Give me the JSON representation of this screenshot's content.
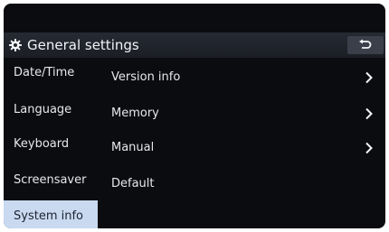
{
  "header": {
    "title": "General settings",
    "icon": "gear-icon",
    "back_icon": "back-icon"
  },
  "sidebar": {
    "items": [
      {
        "label": "Date/Time",
        "active": false
      },
      {
        "label": "Language",
        "active": false
      },
      {
        "label": "Keyboard",
        "active": false
      },
      {
        "label": "Screensaver",
        "active": false
      },
      {
        "label": "System info",
        "active": true
      }
    ]
  },
  "main": {
    "rows": [
      {
        "label": "Version info",
        "chevron": true
      },
      {
        "label": "Memory",
        "chevron": true
      },
      {
        "label": "Manual",
        "chevron": true
      },
      {
        "label": "Default",
        "chevron": false
      }
    ]
  },
  "colors": {
    "background": "#0b0c10",
    "header": "#22252c",
    "active_item": "#c9d9f0",
    "text": "#e6e8ec"
  }
}
